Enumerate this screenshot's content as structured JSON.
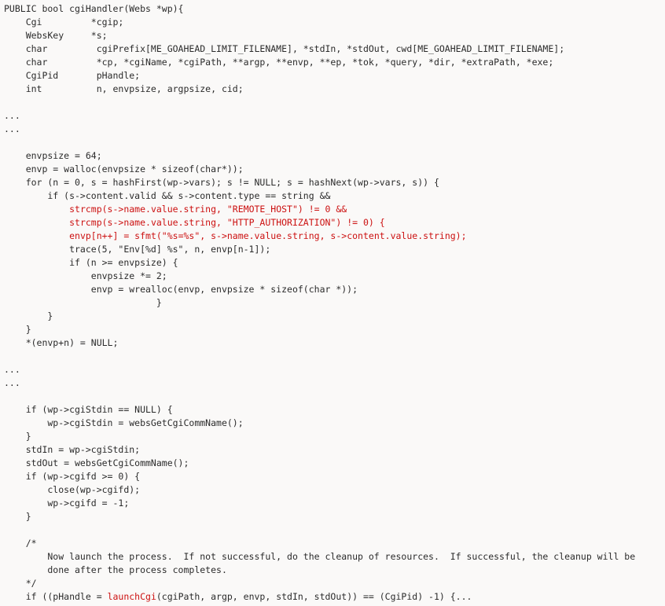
{
  "document": {
    "kind": "source-code-listing",
    "language": "C",
    "function_name": "cgiHandler",
    "background_color": "#faf9f8",
    "default_text_color": "#2b2b2b",
    "highlight_text_color": "#cc1111"
  },
  "lines": [
    {
      "id": 1,
      "segments": [
        {
          "text": "PUBLIC bool cgiHandler(Webs *wp){",
          "style": "plain"
        }
      ]
    },
    {
      "id": 2,
      "segments": [
        {
          "text": "    Cgi         *cgip;",
          "style": "plain"
        }
      ]
    },
    {
      "id": 3,
      "segments": [
        {
          "text": "    WebsKey     *s;",
          "style": "plain"
        }
      ]
    },
    {
      "id": 4,
      "segments": [
        {
          "text": "    char         cgiPrefix[ME_GOAHEAD_LIMIT_FILENAME], *stdIn, *stdOut, cwd[ME_GOAHEAD_LIMIT_FILENAME];",
          "style": "plain"
        }
      ]
    },
    {
      "id": 5,
      "segments": [
        {
          "text": "    char         *cp, *cgiName, *cgiPath, **argp, **envp, **ep, *tok, *query, *dir, *extraPath, *exe;",
          "style": "plain"
        }
      ]
    },
    {
      "id": 6,
      "segments": [
        {
          "text": "    CgiPid       pHandle;",
          "style": "plain"
        }
      ]
    },
    {
      "id": 7,
      "segments": [
        {
          "text": "    int          n, envpsize, argpsize, cid;",
          "style": "plain"
        }
      ]
    },
    {
      "id": 8,
      "segments": [
        {
          "text": "",
          "style": "plain"
        }
      ]
    },
    {
      "id": 9,
      "segments": [
        {
          "text": "...",
          "style": "plain"
        }
      ]
    },
    {
      "id": 10,
      "segments": [
        {
          "text": "...",
          "style": "plain"
        }
      ]
    },
    {
      "id": 11,
      "segments": [
        {
          "text": "",
          "style": "plain"
        }
      ]
    },
    {
      "id": 12,
      "segments": [
        {
          "text": "    envpsize = 64;",
          "style": "plain"
        }
      ]
    },
    {
      "id": 13,
      "segments": [
        {
          "text": "    envp = walloc(envpsize * sizeof(char*));",
          "style": "plain"
        }
      ]
    },
    {
      "id": 14,
      "segments": [
        {
          "text": "    for (n = 0, s = hashFirst(wp->vars); s != NULL; s = hashNext(wp->vars, s)) {",
          "style": "plain"
        }
      ]
    },
    {
      "id": 15,
      "segments": [
        {
          "text": "        if (s->content.valid && s->content.type == string &&",
          "style": "plain"
        }
      ]
    },
    {
      "id": 16,
      "segments": [
        {
          "text": "            ",
          "style": "plain"
        },
        {
          "text": "strcmp(s->name.value.string, \"REMOTE_HOST\") != 0 &&",
          "style": "highlight"
        }
      ]
    },
    {
      "id": 17,
      "segments": [
        {
          "text": "            ",
          "style": "plain"
        },
        {
          "text": "strcmp(s->name.value.string, \"HTTP_AUTHORIZATION\") != 0) {",
          "style": "highlight"
        }
      ]
    },
    {
      "id": 18,
      "segments": [
        {
          "text": "            ",
          "style": "plain"
        },
        {
          "text": "envp[n++] = sfmt(\"%s=%s\", s->name.value.string, s->content.value.string);",
          "style": "highlight"
        }
      ]
    },
    {
      "id": 19,
      "segments": [
        {
          "text": "            trace(5, \"Env[%d] %s\", n, envp[n-1]);",
          "style": "plain"
        }
      ]
    },
    {
      "id": 20,
      "segments": [
        {
          "text": "            if (n >= envpsize) {",
          "style": "plain"
        }
      ]
    },
    {
      "id": 21,
      "segments": [
        {
          "text": "                envpsize *= 2;",
          "style": "plain"
        }
      ]
    },
    {
      "id": 22,
      "segments": [
        {
          "text": "                envp = wrealloc(envp, envpsize * sizeof(char *));",
          "style": "plain"
        }
      ]
    },
    {
      "id": 23,
      "segments": [
        {
          "text": "                            }",
          "style": "plain"
        }
      ]
    },
    {
      "id": 24,
      "segments": [
        {
          "text": "        }",
          "style": "plain"
        }
      ]
    },
    {
      "id": 25,
      "segments": [
        {
          "text": "    }",
          "style": "plain"
        }
      ]
    },
    {
      "id": 26,
      "segments": [
        {
          "text": "    *(envp+n) = NULL;",
          "style": "plain"
        }
      ]
    },
    {
      "id": 27,
      "segments": [
        {
          "text": "",
          "style": "plain"
        }
      ]
    },
    {
      "id": 28,
      "segments": [
        {
          "text": "...",
          "style": "plain"
        }
      ]
    },
    {
      "id": 29,
      "segments": [
        {
          "text": "...",
          "style": "plain"
        }
      ]
    },
    {
      "id": 30,
      "segments": [
        {
          "text": "",
          "style": "plain"
        }
      ]
    },
    {
      "id": 31,
      "segments": [
        {
          "text": "    if (wp->cgiStdin == NULL) {",
          "style": "plain"
        }
      ]
    },
    {
      "id": 32,
      "segments": [
        {
          "text": "        wp->cgiStdin = websGetCgiCommName();",
          "style": "plain"
        }
      ]
    },
    {
      "id": 33,
      "segments": [
        {
          "text": "    }",
          "style": "plain"
        }
      ]
    },
    {
      "id": 34,
      "segments": [
        {
          "text": "    stdIn = wp->cgiStdin;",
          "style": "plain"
        }
      ]
    },
    {
      "id": 35,
      "segments": [
        {
          "text": "    stdOut = websGetCgiCommName();",
          "style": "plain"
        }
      ]
    },
    {
      "id": 36,
      "segments": [
        {
          "text": "    if (wp->cgifd >= 0) {",
          "style": "plain"
        }
      ]
    },
    {
      "id": 37,
      "segments": [
        {
          "text": "        close(wp->cgifd);",
          "style": "plain"
        }
      ]
    },
    {
      "id": 38,
      "segments": [
        {
          "text": "        wp->cgifd = -1;",
          "style": "plain"
        }
      ]
    },
    {
      "id": 39,
      "segments": [
        {
          "text": "    }",
          "style": "plain"
        }
      ]
    },
    {
      "id": 40,
      "segments": [
        {
          "text": "",
          "style": "plain"
        }
      ]
    },
    {
      "id": 41,
      "segments": [
        {
          "text": "    /*",
          "style": "plain"
        }
      ]
    },
    {
      "id": 42,
      "segments": [
        {
          "text": "        Now launch the process.  If not successful, do the cleanup of resources.  If successful, the cleanup will be",
          "style": "plain"
        }
      ]
    },
    {
      "id": 43,
      "segments": [
        {
          "text": "        done after the process completes.",
          "style": "plain"
        }
      ]
    },
    {
      "id": 44,
      "segments": [
        {
          "text": "    */",
          "style": "plain"
        }
      ]
    },
    {
      "id": 45,
      "segments": [
        {
          "text": "    if ((pHandle = ",
          "style": "plain"
        },
        {
          "text": "launchCgi",
          "style": "highlight"
        },
        {
          "text": "(cgiPath, argp, envp, stdIn, stdOut)) == (CgiPid) -1) {...",
          "style": "plain"
        }
      ]
    }
  ]
}
